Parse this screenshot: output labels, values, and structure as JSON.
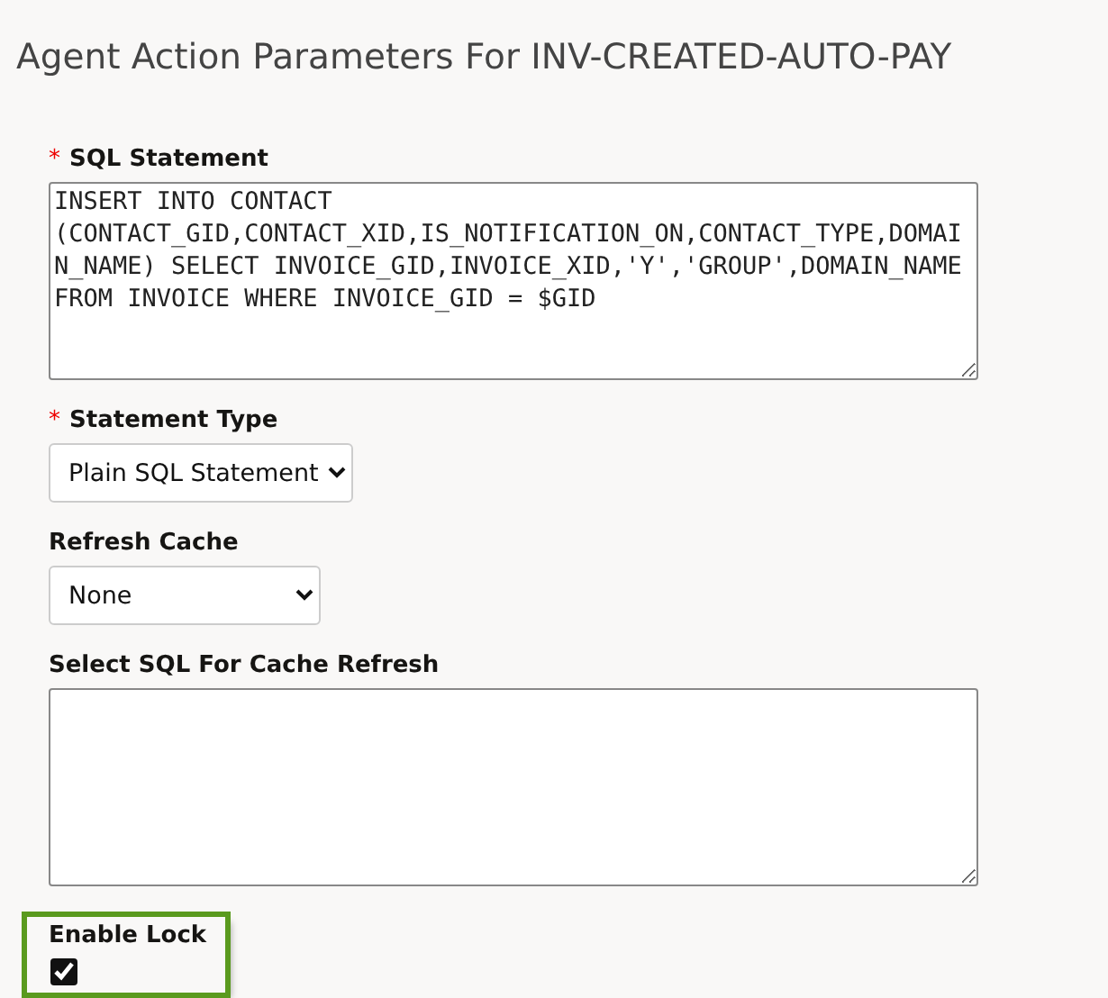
{
  "title": "Agent Action Parameters For INV-CREATED-AUTO-PAY",
  "fields": [
    {
      "kind": "textarea",
      "label": "SQL Statement",
      "marker": "*",
      "value": "INSERT INTO CONTACT (CONTACT_GID,CONTACT_XID,IS_NOTIFICATION_ON,CONTACT_TYPE,DOMAIN_NAME) SELECT INVOICE_GID,INVOICE_XID,'Y','GROUP',DOMAIN_NAME FROM INVOICE WHERE INVOICE_GID = $GID"
    },
    {
      "kind": "select",
      "label": "Statement Type",
      "marker": "*",
      "value": "Plain SQL Statement"
    },
    {
      "kind": "select",
      "label": "Refresh Cache",
      "value": "None"
    },
    {
      "kind": "textarea",
      "label": "Select SQL For Cache Refresh"
    },
    {
      "kind": "checkbox",
      "label": "Enable Lock",
      "checked": true,
      "highlighted": true
    }
  ]
}
